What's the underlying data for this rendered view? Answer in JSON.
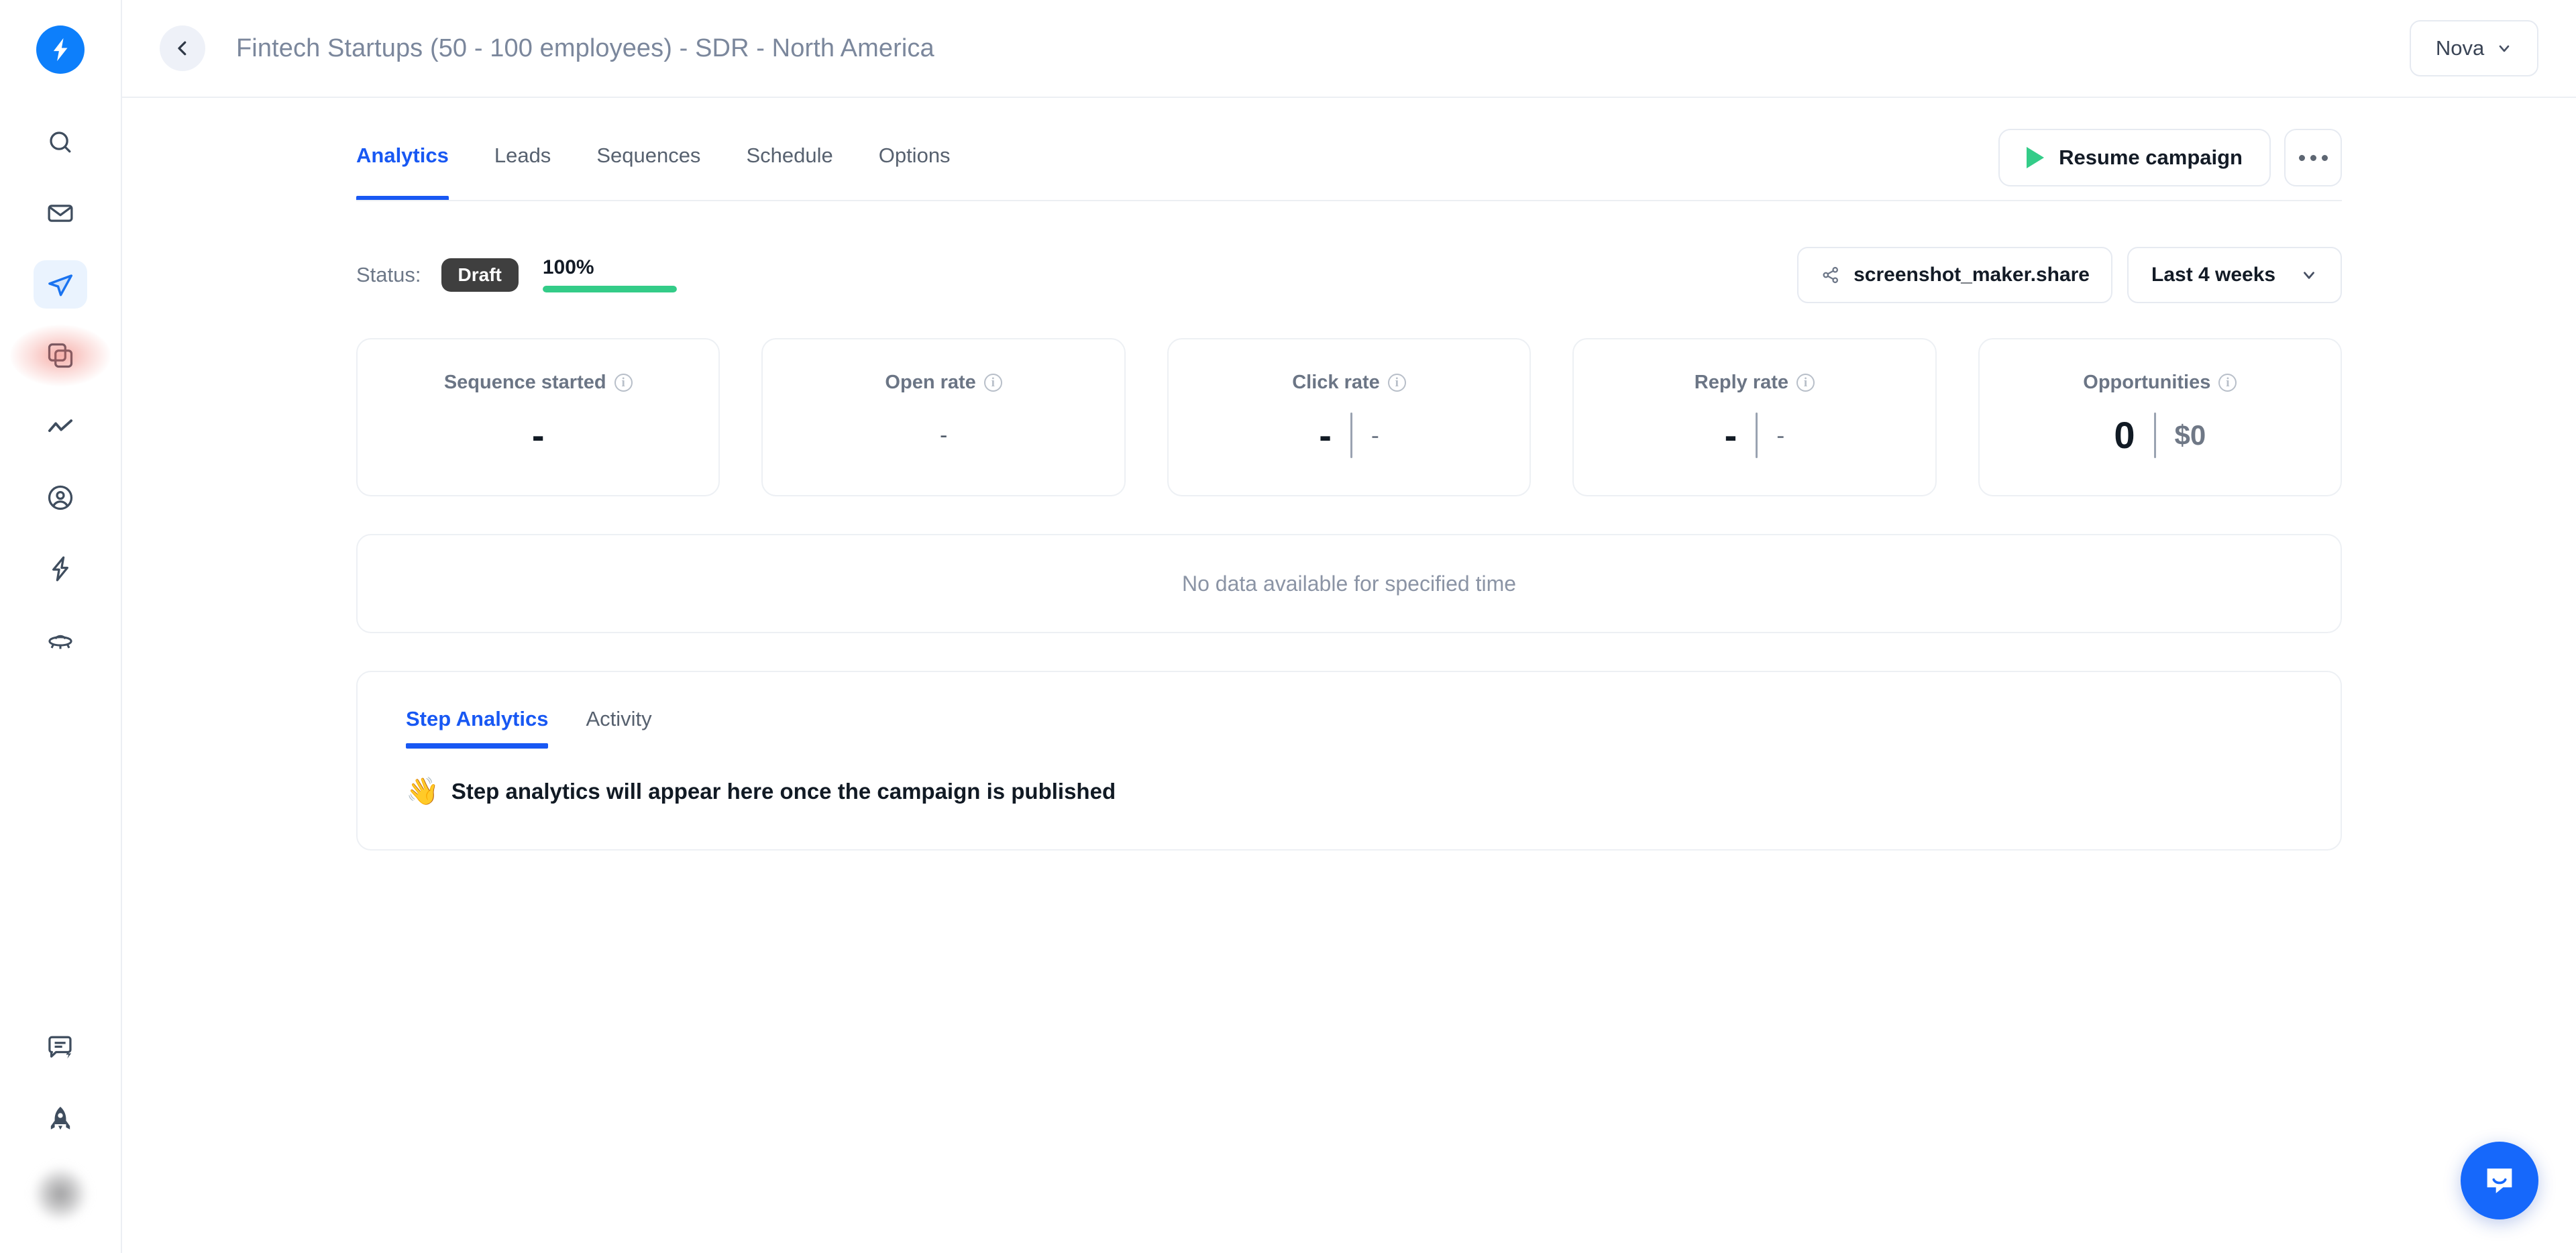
{
  "brand": {
    "logo_icon": "lightning-bolt-logo",
    "accent_blue": "#1858f3",
    "logo_blue": "#0d7ffb",
    "green": "#33cc88",
    "dark": "#131b26"
  },
  "sidebar": {
    "top_items": [
      {
        "name": "search",
        "icon": "search-icon",
        "active": false,
        "alert": false
      },
      {
        "name": "inbox",
        "icon": "envelope-icon",
        "active": false,
        "alert": false
      },
      {
        "name": "campaigns",
        "icon": "paper-plane-icon",
        "active": true,
        "alert": false
      },
      {
        "name": "templates",
        "icon": "copy-layers-icon",
        "active": false,
        "alert": true
      },
      {
        "name": "analytics",
        "icon": "line-chart-icon",
        "active": false,
        "alert": false
      },
      {
        "name": "contacts",
        "icon": "user-circle-icon",
        "active": false,
        "alert": false
      },
      {
        "name": "automations",
        "icon": "lightning-icon",
        "active": false,
        "alert": false
      },
      {
        "name": "integrations",
        "icon": "ufo-icon",
        "active": false,
        "alert": false
      }
    ],
    "bottom_items": [
      {
        "name": "feedback",
        "icon": "chat-lightning-icon"
      },
      {
        "name": "whats-new",
        "icon": "rocket-icon"
      },
      {
        "name": "account-avatar",
        "icon": "avatar-blurred"
      }
    ]
  },
  "topbar": {
    "back_icon": "chevron-left-icon",
    "title": "Fintech Startups (50 - 100 employees) - SDR - North America",
    "workspace_label": "Nova",
    "workspace_caret_icon": "chevron-down-icon"
  },
  "tabs": [
    {
      "label": "Analytics",
      "active": true
    },
    {
      "label": "Leads",
      "active": false
    },
    {
      "label": "Sequences",
      "active": false
    },
    {
      "label": "Schedule",
      "active": false
    },
    {
      "label": "Options",
      "active": false
    }
  ],
  "actions": {
    "resume_label": "Resume campaign",
    "resume_icon": "play-icon",
    "more_icon": "ellipsis-icon"
  },
  "status": {
    "label": "Status:",
    "badge": "Draft",
    "progress_text": "100%",
    "progress_value": 100
  },
  "toolbar": {
    "share_label": "screenshot_maker.share",
    "share_icon": "share-nodes-icon",
    "range_label": "Last 4 weeks",
    "range_caret_icon": "chevron-down-icon"
  },
  "metrics": [
    {
      "title": "Sequence started",
      "info_icon": "info-icon",
      "major": "-",
      "major_style": "bold",
      "has_sep": false,
      "minor": ""
    },
    {
      "title": "Open rate",
      "info_icon": "info-icon",
      "major": "-",
      "major_style": "light",
      "has_sep": false,
      "minor": ""
    },
    {
      "title": "Click rate",
      "info_icon": "info-icon",
      "major": "-",
      "major_style": "bold",
      "has_sep": true,
      "minor": "-"
    },
    {
      "title": "Reply rate",
      "info_icon": "info-icon",
      "major": "-",
      "major_style": "bold",
      "has_sep": true,
      "minor": "-"
    },
    {
      "title": "Opportunities",
      "info_icon": "info-icon",
      "major": "0",
      "major_style": "bold",
      "has_sep": true,
      "minor": "$0"
    }
  ],
  "chart_panel": {
    "empty_message": "No data available for specified time"
  },
  "step_section": {
    "tabs": [
      {
        "label": "Step Analytics",
        "active": true
      },
      {
        "label": "Activity",
        "active": false
      }
    ],
    "emoji": "👋",
    "message": "Step analytics will appear here once the campaign is published"
  },
  "chat": {
    "icon": "chat-smile-icon"
  }
}
